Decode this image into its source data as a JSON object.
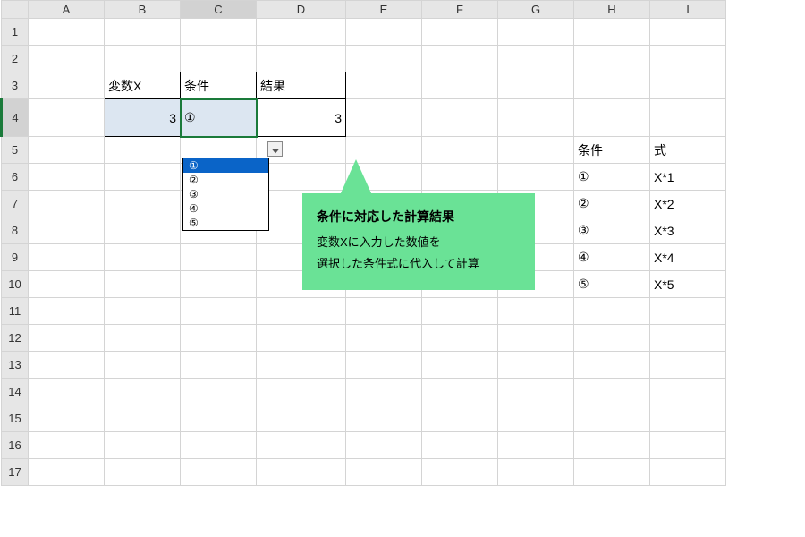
{
  "columns": [
    "A",
    "B",
    "C",
    "D",
    "E",
    "F",
    "G",
    "H",
    "I"
  ],
  "rows": [
    "1",
    "2",
    "3",
    "4",
    "5",
    "6",
    "7",
    "8",
    "9",
    "10",
    "11",
    "12",
    "13",
    "14",
    "15",
    "16",
    "17"
  ],
  "activeCell": "C4",
  "headers": {
    "B3": "変数X",
    "C3": "条件",
    "D3": "結果"
  },
  "values": {
    "B4": "3",
    "C4": "①",
    "D4": "3"
  },
  "dropdown": {
    "options": [
      "①",
      "②",
      "③",
      "④",
      "⑤"
    ],
    "selected": "①"
  },
  "callout": {
    "title": "条件に対応した計算結果",
    "line1": "変数Xに入力した数値を",
    "line2": "選択した条件式に代入して計算"
  },
  "lookup": {
    "header_cond": "条件",
    "header_formula": "式",
    "rows": [
      {
        "cond": "①",
        "formula": "X*1"
      },
      {
        "cond": "②",
        "formula": "X*2"
      },
      {
        "cond": "③",
        "formula": "X*3"
      },
      {
        "cond": "④",
        "formula": "X*4"
      },
      {
        "cond": "⑤",
        "formula": "X*5"
      }
    ]
  }
}
